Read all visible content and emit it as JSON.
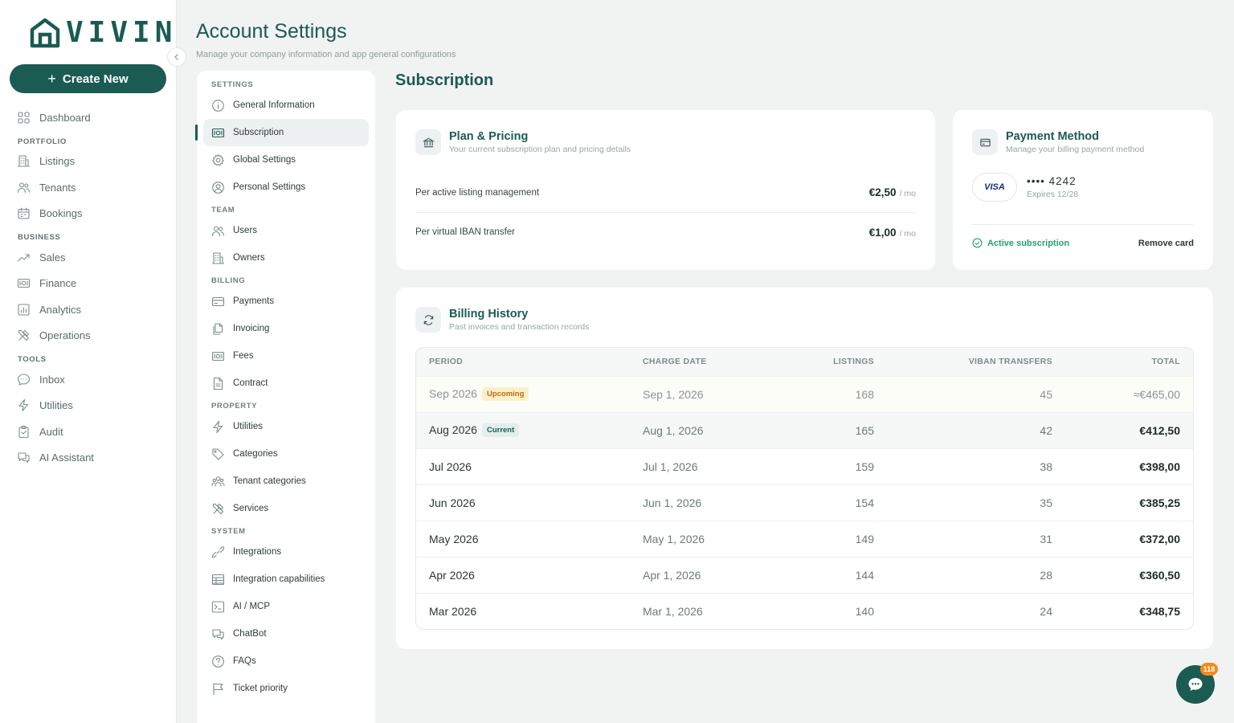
{
  "app": {
    "logo_text": "VIVIN",
    "create_new_label": "Create New",
    "collapse_icon": "chevron-left-icon"
  },
  "sidebar": {
    "items": [
      {
        "label": "Dashboard",
        "icon": "grid-icon"
      },
      {
        "section": "PORTFOLIO"
      },
      {
        "label": "Listings",
        "icon": "building-icon"
      },
      {
        "label": "Tenants",
        "icon": "users-icon"
      },
      {
        "label": "Bookings",
        "icon": "calendar-icon"
      },
      {
        "section": "BUSINESS"
      },
      {
        "label": "Sales",
        "icon": "trend-up-icon"
      },
      {
        "label": "Finance",
        "icon": "banknote-icon"
      },
      {
        "label": "Analytics",
        "icon": "bar-chart-icon"
      },
      {
        "label": "Operations",
        "icon": "tools-icon"
      },
      {
        "section": "TOOLS"
      },
      {
        "label": "Inbox",
        "icon": "chat-bubble-icon"
      },
      {
        "label": "Utilities",
        "icon": "bolt-icon"
      },
      {
        "label": "Audit",
        "icon": "clipboard-icon"
      },
      {
        "label": "AI Assistant",
        "icon": "messages-icon"
      }
    ]
  },
  "header": {
    "title": "Account Settings",
    "subtitle": "Manage your company information and app general configurations"
  },
  "settings_menu": {
    "items": [
      {
        "section": "SETTINGS"
      },
      {
        "label": "General Information",
        "icon": "info-icon"
      },
      {
        "label": "Subscription",
        "icon": "banknote-icon",
        "active": true
      },
      {
        "label": "Global Settings",
        "icon": "gear-icon"
      },
      {
        "label": "Personal Settings",
        "icon": "user-circle-icon"
      },
      {
        "section": "TEAM"
      },
      {
        "label": "Users",
        "icon": "users-icon"
      },
      {
        "label": "Owners",
        "icon": "building-icon"
      },
      {
        "section": "BILLING"
      },
      {
        "label": "Payments",
        "icon": "credit-card-icon"
      },
      {
        "label": "Invoicing",
        "icon": "documents-icon"
      },
      {
        "label": "Fees",
        "icon": "banknote-icon"
      },
      {
        "label": "Contract",
        "icon": "file-icon"
      },
      {
        "section": "PROPERTY"
      },
      {
        "label": "Utilities",
        "icon": "bolt-icon"
      },
      {
        "label": "Categories",
        "icon": "tag-icon"
      },
      {
        "label": "Tenant categories",
        "icon": "users-group-icon"
      },
      {
        "label": "Services",
        "icon": "tools-icon"
      },
      {
        "section": "SYSTEM"
      },
      {
        "label": "Integrations",
        "icon": "link-icon"
      },
      {
        "label": "Integration capabilities",
        "icon": "table-icon"
      },
      {
        "label": "AI / MCP",
        "icon": "terminal-icon"
      },
      {
        "label": "ChatBot",
        "icon": "messages-icon"
      },
      {
        "label": "FAQs",
        "icon": "question-icon"
      },
      {
        "label": "Ticket priority",
        "icon": "flag-icon"
      }
    ]
  },
  "main": {
    "section_title": "Subscription",
    "plan": {
      "title": "Plan & Pricing",
      "subtitle": "Your current subscription plan and pricing details",
      "icon": "bank-icon",
      "rows": [
        {
          "label": "Per active listing management",
          "value": "€2,50",
          "unit": "/ mo"
        },
        {
          "label": "Per virtual IBAN transfer",
          "value": "€1,00",
          "unit": "/ mo"
        }
      ]
    },
    "payment": {
      "title": "Payment Method",
      "subtitle": "Manage your billing payment method",
      "icon": "credit-card-icon",
      "brand": "VISA",
      "masked": "•••• 4242",
      "expires": "Expires 12/28",
      "status": "Active subscription",
      "remove_label": "Remove card"
    },
    "billing": {
      "title": "Billing History",
      "subtitle": "Past invoices and transaction records",
      "icon": "refresh-icon",
      "columns": [
        "PERIOD",
        "CHARGE DATE",
        "LISTINGS",
        "VIBAN TRANSFERS",
        "TOTAL"
      ],
      "rows": [
        {
          "period": "Sep 2026",
          "badge": "Upcoming",
          "status": "upcoming",
          "date": "Sep 1, 2026",
          "listings": "168",
          "viban": "45",
          "total": "≈€465,00"
        },
        {
          "period": "Aug 2026",
          "badge": "Current",
          "status": "current",
          "date": "Aug 1, 2026",
          "listings": "165",
          "viban": "42",
          "total": "€412,50"
        },
        {
          "period": "Jul 2026",
          "badge": "",
          "status": "",
          "date": "Jul 1, 2026",
          "listings": "159",
          "viban": "38",
          "total": "€398,00"
        },
        {
          "period": "Jun 2026",
          "badge": "",
          "status": "",
          "date": "Jun 1, 2026",
          "listings": "154",
          "viban": "35",
          "total": "€385,25"
        },
        {
          "period": "May 2026",
          "badge": "",
          "status": "",
          "date": "May 1, 2026",
          "listings": "149",
          "viban": "31",
          "total": "€372,00"
        },
        {
          "period": "Apr 2026",
          "badge": "",
          "status": "",
          "date": "Apr 1, 2026",
          "listings": "144",
          "viban": "28",
          "total": "€360,50"
        },
        {
          "period": "Mar 2026",
          "badge": "",
          "status": "",
          "date": "Mar 1, 2026",
          "listings": "140",
          "viban": "24",
          "total": "€348,75"
        }
      ]
    }
  },
  "chat": {
    "badge_count": "118",
    "icon": "chat-bubble-icon"
  },
  "colors": {
    "brand": "#1b5b52",
    "active_status": "#23a26d",
    "upcoming_badge": "#b76c12",
    "chat_badge": "#f08b1b"
  }
}
